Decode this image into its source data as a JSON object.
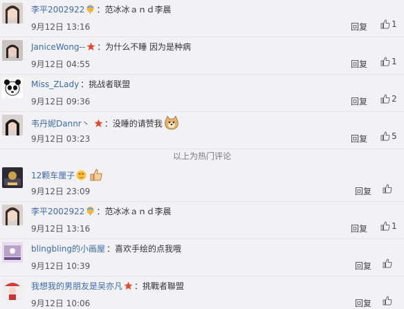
{
  "hot_divider": "以上为热门评论",
  "comments": [
    {
      "user": "李平2002922",
      "text": "范冰冰ａｎｄ李晨",
      "time": "9月12日 13:16",
      "reply": "回复",
      "likes": "1",
      "badge": "balloon",
      "emoji": false
    },
    {
      "user": "JaniceWong--",
      "text": "为什么不睡 因为是种病",
      "time": "9月12日 04:55",
      "reply": "回复",
      "likes": "1",
      "badge": "star",
      "emoji": false
    },
    {
      "user": "Miss_ZLady",
      "text": "挑战者联盟",
      "time": "9月12日 09:36",
      "reply": "回复",
      "likes": "2",
      "badge": "",
      "emoji": false
    },
    {
      "user": "韦丹妮Dannr丶",
      "text": "没睡的请赞我",
      "time": "9月12日 03:23",
      "reply": "回复",
      "likes": "5",
      "badge": "star",
      "emoji": "doge"
    },
    {
      "user": "12颗车厘子",
      "text": "",
      "time": "9月12日 23:09",
      "reply": "回复",
      "likes": "",
      "badge": "heart-eyes",
      "emoji": "thumb"
    },
    {
      "user": "李平2002922",
      "text": "范冰冰ａｎｄ李晨",
      "time": "9月12日 13:16",
      "reply": "回复",
      "likes": "1",
      "badge": "balloon",
      "emoji": false
    },
    {
      "user": "blingbling的小画屋",
      "text": "喜欢手绘的点我哦",
      "time": "9月12日 10:39",
      "reply": "回复",
      "likes": "",
      "badge": "",
      "emoji": false
    },
    {
      "user": "我想我的男朋友是吴亦凡",
      "text": "挑戰者聯盟",
      "time": "9月12日 10:06",
      "reply": "回复",
      "likes": "",
      "badge": "star",
      "emoji": false
    }
  ],
  "colors": {
    "username": "#3b6ab0",
    "star": "#e8452c",
    "background": "#f2f2f5"
  }
}
